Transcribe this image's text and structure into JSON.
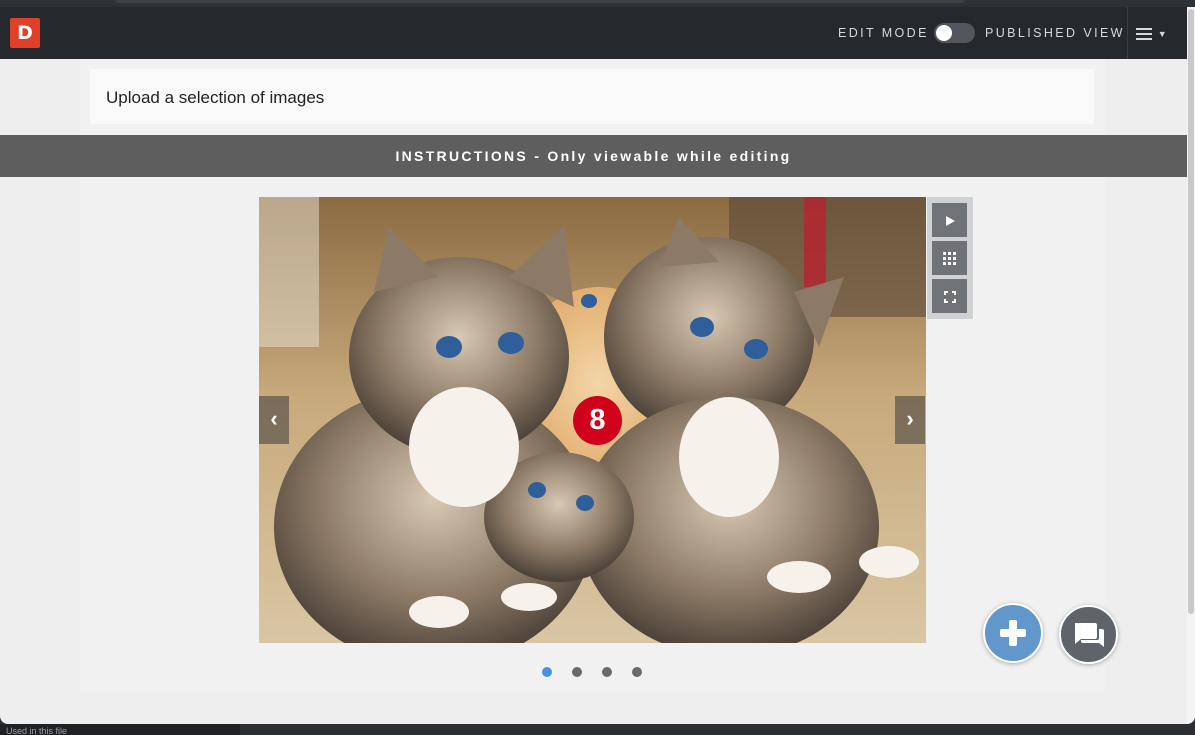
{
  "navbar": {
    "logo_text": "D",
    "edit_mode_label": "EDIT MODE",
    "published_view_label": "PUBLISHED VIEW",
    "menu_icon": "hamburger-icon",
    "menu_caret_icon": "caret-down-icon"
  },
  "page": {
    "title": "Upload a selection of images",
    "instructions": "INSTRUCTIONS - Only viewable while editing"
  },
  "slideshow": {
    "badge_number": "8",
    "prev_icon": "chevron-left-icon",
    "next_icon": "chevron-right-icon",
    "tools": [
      "play-icon",
      "grid-icon",
      "fullscreen-icon"
    ],
    "slide_count": 4,
    "active_slide": 1
  },
  "fabs": {
    "add_icon": "plus-icon",
    "chat_icon": "chat-icon"
  },
  "bottom_panel": {
    "label": "Used in this file"
  },
  "colors": {
    "logo": "#e0402a",
    "navbar": "#25282c",
    "badge": "#d0021b",
    "add_button": "#6197cb",
    "chat_button": "#5f646b",
    "active_dot": "#4a90e2"
  }
}
